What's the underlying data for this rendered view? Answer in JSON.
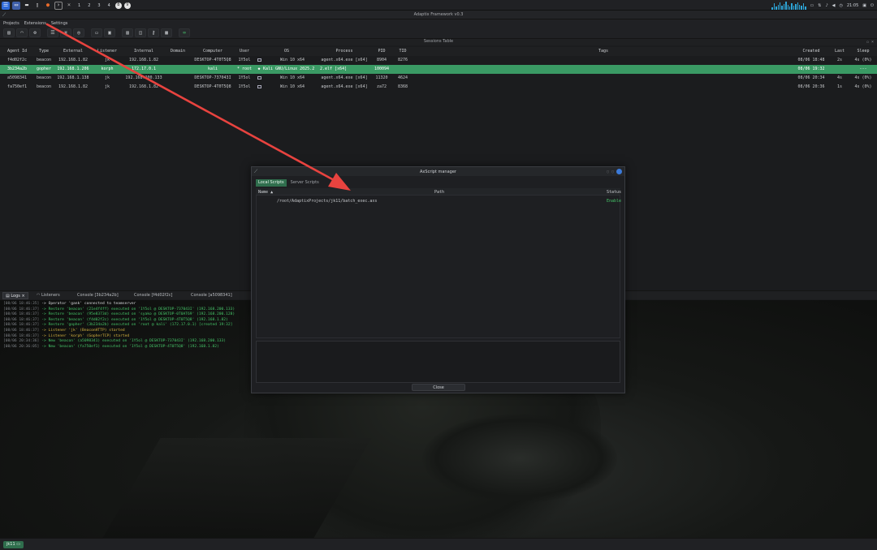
{
  "taskbar": {
    "workspaces": [
      "1",
      "2",
      "3",
      "4"
    ],
    "badges": [
      "8",
      "9"
    ],
    "time": "21:05",
    "sparkline": [
      3,
      8,
      4,
      6,
      9,
      5,
      7,
      10,
      6,
      4,
      8,
      5,
      7,
      9,
      6,
      5,
      8,
      4
    ]
  },
  "window": {
    "title": "Adaptix Framework v0.3"
  },
  "menu": [
    "Projects",
    "Extensions",
    "Settings"
  ],
  "sessions": {
    "title": "Sessions Table",
    "columns": [
      "Agent Id",
      "Type",
      "External",
      "Listener",
      "Internal",
      "Domain",
      "Computer",
      "User",
      "OS",
      "Process",
      "PID",
      "TID",
      "Tags",
      "Created",
      "Last",
      "Sleep"
    ],
    "rows": [
      {
        "id": "f4d02f2c",
        "type": "beacon",
        "external": "192.168.1.82",
        "listener": "jk",
        "internal": "192.168.1.82",
        "domain": "",
        "computer": "DESKTOP-4T0T5Q8",
        "user": "1Y5ol",
        "os": "Win 10 x64",
        "process": "agent.x64.exe [x64]",
        "pid": "8904",
        "tid": "8276",
        "tags": "",
        "created": "08/06 18:48",
        "last": "2s",
        "sleep": "4s (0%)",
        "selected": false
      },
      {
        "id": "3b234a2b",
        "type": "gopher",
        "external": "192.168.1.206",
        "listener": "korph",
        "internal": "172.17.0.1",
        "domain": "",
        "computer": "kali",
        "user": "* root",
        "os": "Kali GNU/Linux 2025.2",
        "process": "2.elf [x64]",
        "pid": "100094",
        "tid": "",
        "tags": "",
        "created": "08/06 19:32",
        "last": "",
        "sleep": "---",
        "selected": true
      },
      {
        "id": "a5098341",
        "type": "beacon",
        "external": "192.168.1.138",
        "listener": "jk",
        "internal": "192.168.200.133",
        "domain": "",
        "computer": "DESKTOP-737043I",
        "user": "1Y5ol",
        "os": "Win 10 x64",
        "process": "agent.x64.exe [x64]",
        "pid": "11320",
        "tid": "4624",
        "tags": "",
        "created": "08/06 20:34",
        "last": "4s",
        "sleep": "4s (0%)",
        "selected": false
      },
      {
        "id": "fa750ef1",
        "type": "beacon",
        "external": "192.168.1.82",
        "listener": "jk",
        "internal": "192.168.1.82",
        "domain": "",
        "computer": "DESKTOP-4T0T5Q8",
        "user": "1Y5ol",
        "os": "Win 10 x64",
        "process": "agent.x64.exe [x64]",
        "pid": "za72",
        "tid": "8368",
        "tags": "",
        "created": "08/06 20:36",
        "last": "1s",
        "sleep": "4s (0%)",
        "selected": false
      }
    ]
  },
  "bottom_tabs": [
    "Logs",
    "Listeners",
    "Console [3b234a2b]",
    "Console [f4d02f2c]",
    "Console [a5098341]"
  ],
  "logs": [
    {
      "ts": "[08/06 18:46:35]",
      "msg": "-> Operator 'gank' connected to teamserver",
      "color": "white"
    },
    {
      "ts": "[08/06 18:46:37]",
      "msg": "-> Restore 'beacon' (21e4f4ff) executed on '1Y5ol @ DESKTOP-737043I' (192.168.200.133)",
      "color": "green"
    },
    {
      "ts": "[08/06 18:46:37]",
      "msg": "-> Restore 'beacon' (95e8373d) executed on 'syako @ DESKTOP-0T0AT69' (192.168.200.128)",
      "color": "green"
    },
    {
      "ts": "[08/06 18:46:37]",
      "msg": "-> Restore 'beacon' (f4d02f2c) executed on '1Y5ol @ DESKTOP-4T0T5Q8' (192.168.1.82)",
      "color": "green"
    },
    {
      "ts": "[08/06 18:46:37]",
      "msg": "-> Restore 'gopher' (3b234a2b) executed on 'root @ kali' (172.17.0.1) [created 19:32]",
      "color": "green"
    },
    {
      "ts": "[08/06 18:46:37]",
      "msg": "-> Listener 'jk' (BeaconHTTP) started",
      "color": "yellow"
    },
    {
      "ts": "[08/06 18:46:37]",
      "msg": "-> Listener 'korph' (GopherTCP) started",
      "color": "yellow"
    },
    {
      "ts": "[08/06 20:34:36]",
      "msg": "-> New 'beacon' (a5098341) executed on '1Y5ol @ DESKTOP-737043I' (192.168.200.133)",
      "color": "green"
    },
    {
      "ts": "[08/06 20:36:05]",
      "msg": "-> New 'beacon' (fa750ef1) executed on '1Y5ol @ DESKTOP-4T0T5Q8' (192.168.1.82)",
      "color": "green"
    }
  ],
  "status": {
    "project": "jk11"
  },
  "dialog": {
    "title": "AxScript manager",
    "tabs": [
      "Local Scripts",
      "Server Scripts"
    ],
    "columns": [
      "Name",
      "Path",
      "Status"
    ],
    "sort_indicator": "▲",
    "rows": [
      {
        "name": "",
        "path": "/root/AdaptixProjects/jk11/batch_exec.axs",
        "status": "Enable"
      }
    ],
    "close_label": "Close"
  },
  "colors": {
    "selected_row": "#3a9a64",
    "accent_green": "#45c468",
    "log_yellow": "#d6b341",
    "arrow": "#e8433f"
  }
}
